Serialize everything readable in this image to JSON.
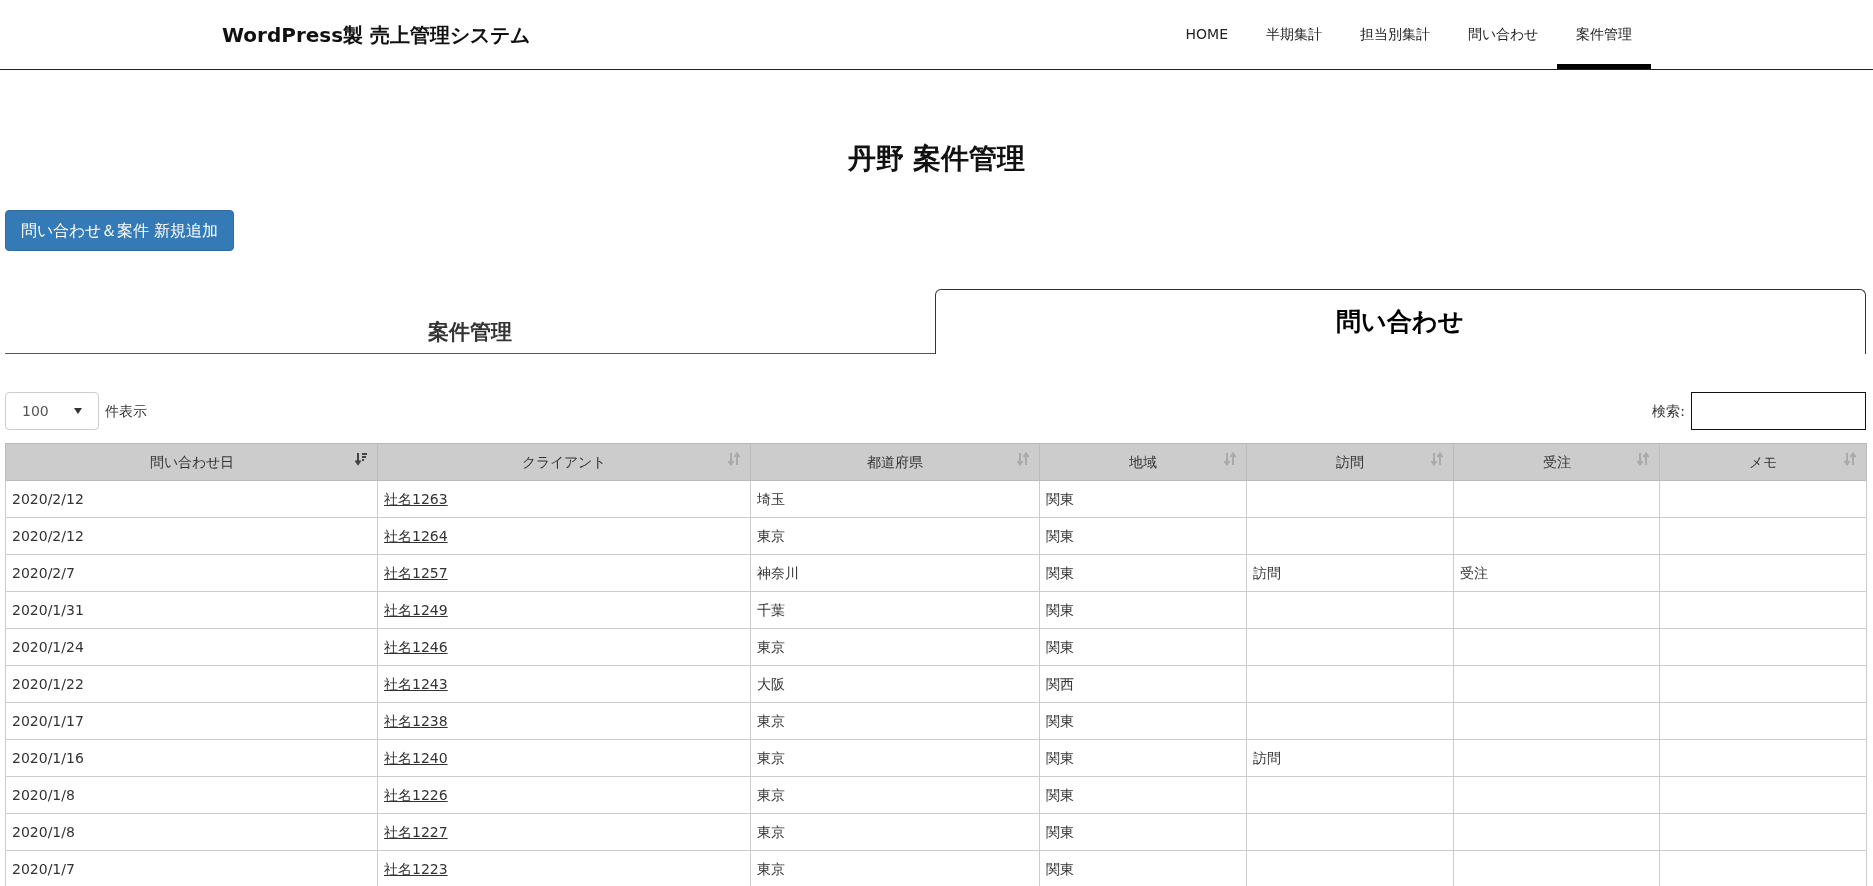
{
  "site_title": "WordPress製 売上管理システム",
  "nav": [
    {
      "label": "HOME",
      "selected": false
    },
    {
      "label": "半期集計",
      "selected": false
    },
    {
      "label": "担当別集計",
      "selected": false
    },
    {
      "label": "問い合わせ",
      "selected": false
    },
    {
      "label": "案件管理",
      "selected": true
    }
  ],
  "page_title": "丹野 案件管理",
  "add_button": "問い合わせ＆案件 新規追加",
  "tabs": [
    {
      "label": "案件管理",
      "selected": false
    },
    {
      "label": "問い合わせ",
      "selected": true
    }
  ],
  "page_length": {
    "value": "100",
    "label": "件表示"
  },
  "search": {
    "label": "検索:"
  },
  "table": {
    "columns": [
      {
        "label": "問い合わせ日",
        "sorted": true
      },
      {
        "label": "クライアント",
        "sorted": false
      },
      {
        "label": "都道府県",
        "sorted": false
      },
      {
        "label": "地域",
        "sorted": false
      },
      {
        "label": "訪問",
        "sorted": false
      },
      {
        "label": "受注",
        "sorted": false
      },
      {
        "label": "メモ",
        "sorted": false
      }
    ],
    "rows": [
      [
        "2020/2/12",
        "社名1263",
        "埼玉",
        "関東",
        "",
        "",
        ""
      ],
      [
        "2020/2/12",
        "社名1264",
        "東京",
        "関東",
        "",
        "",
        ""
      ],
      [
        "2020/2/7",
        "社名1257",
        "神奈川",
        "関東",
        "訪問",
        "受注",
        ""
      ],
      [
        "2020/1/31",
        "社名1249",
        "千葉",
        "関東",
        "",
        "",
        ""
      ],
      [
        "2020/1/24",
        "社名1246",
        "東京",
        "関東",
        "",
        "",
        ""
      ],
      [
        "2020/1/22",
        "社名1243",
        "大阪",
        "関西",
        "",
        "",
        ""
      ],
      [
        "2020/1/17",
        "社名1238",
        "東京",
        "関東",
        "",
        "",
        ""
      ],
      [
        "2020/1/16",
        "社名1240",
        "東京",
        "関東",
        "訪問",
        "",
        ""
      ],
      [
        "2020/1/8",
        "社名1226",
        "東京",
        "関東",
        "",
        "",
        ""
      ],
      [
        "2020/1/8",
        "社名1227",
        "東京",
        "関東",
        "",
        "",
        ""
      ],
      [
        "2020/1/7",
        "社名1223",
        "東京",
        "関東",
        "",
        "",
        ""
      ]
    ]
  }
}
